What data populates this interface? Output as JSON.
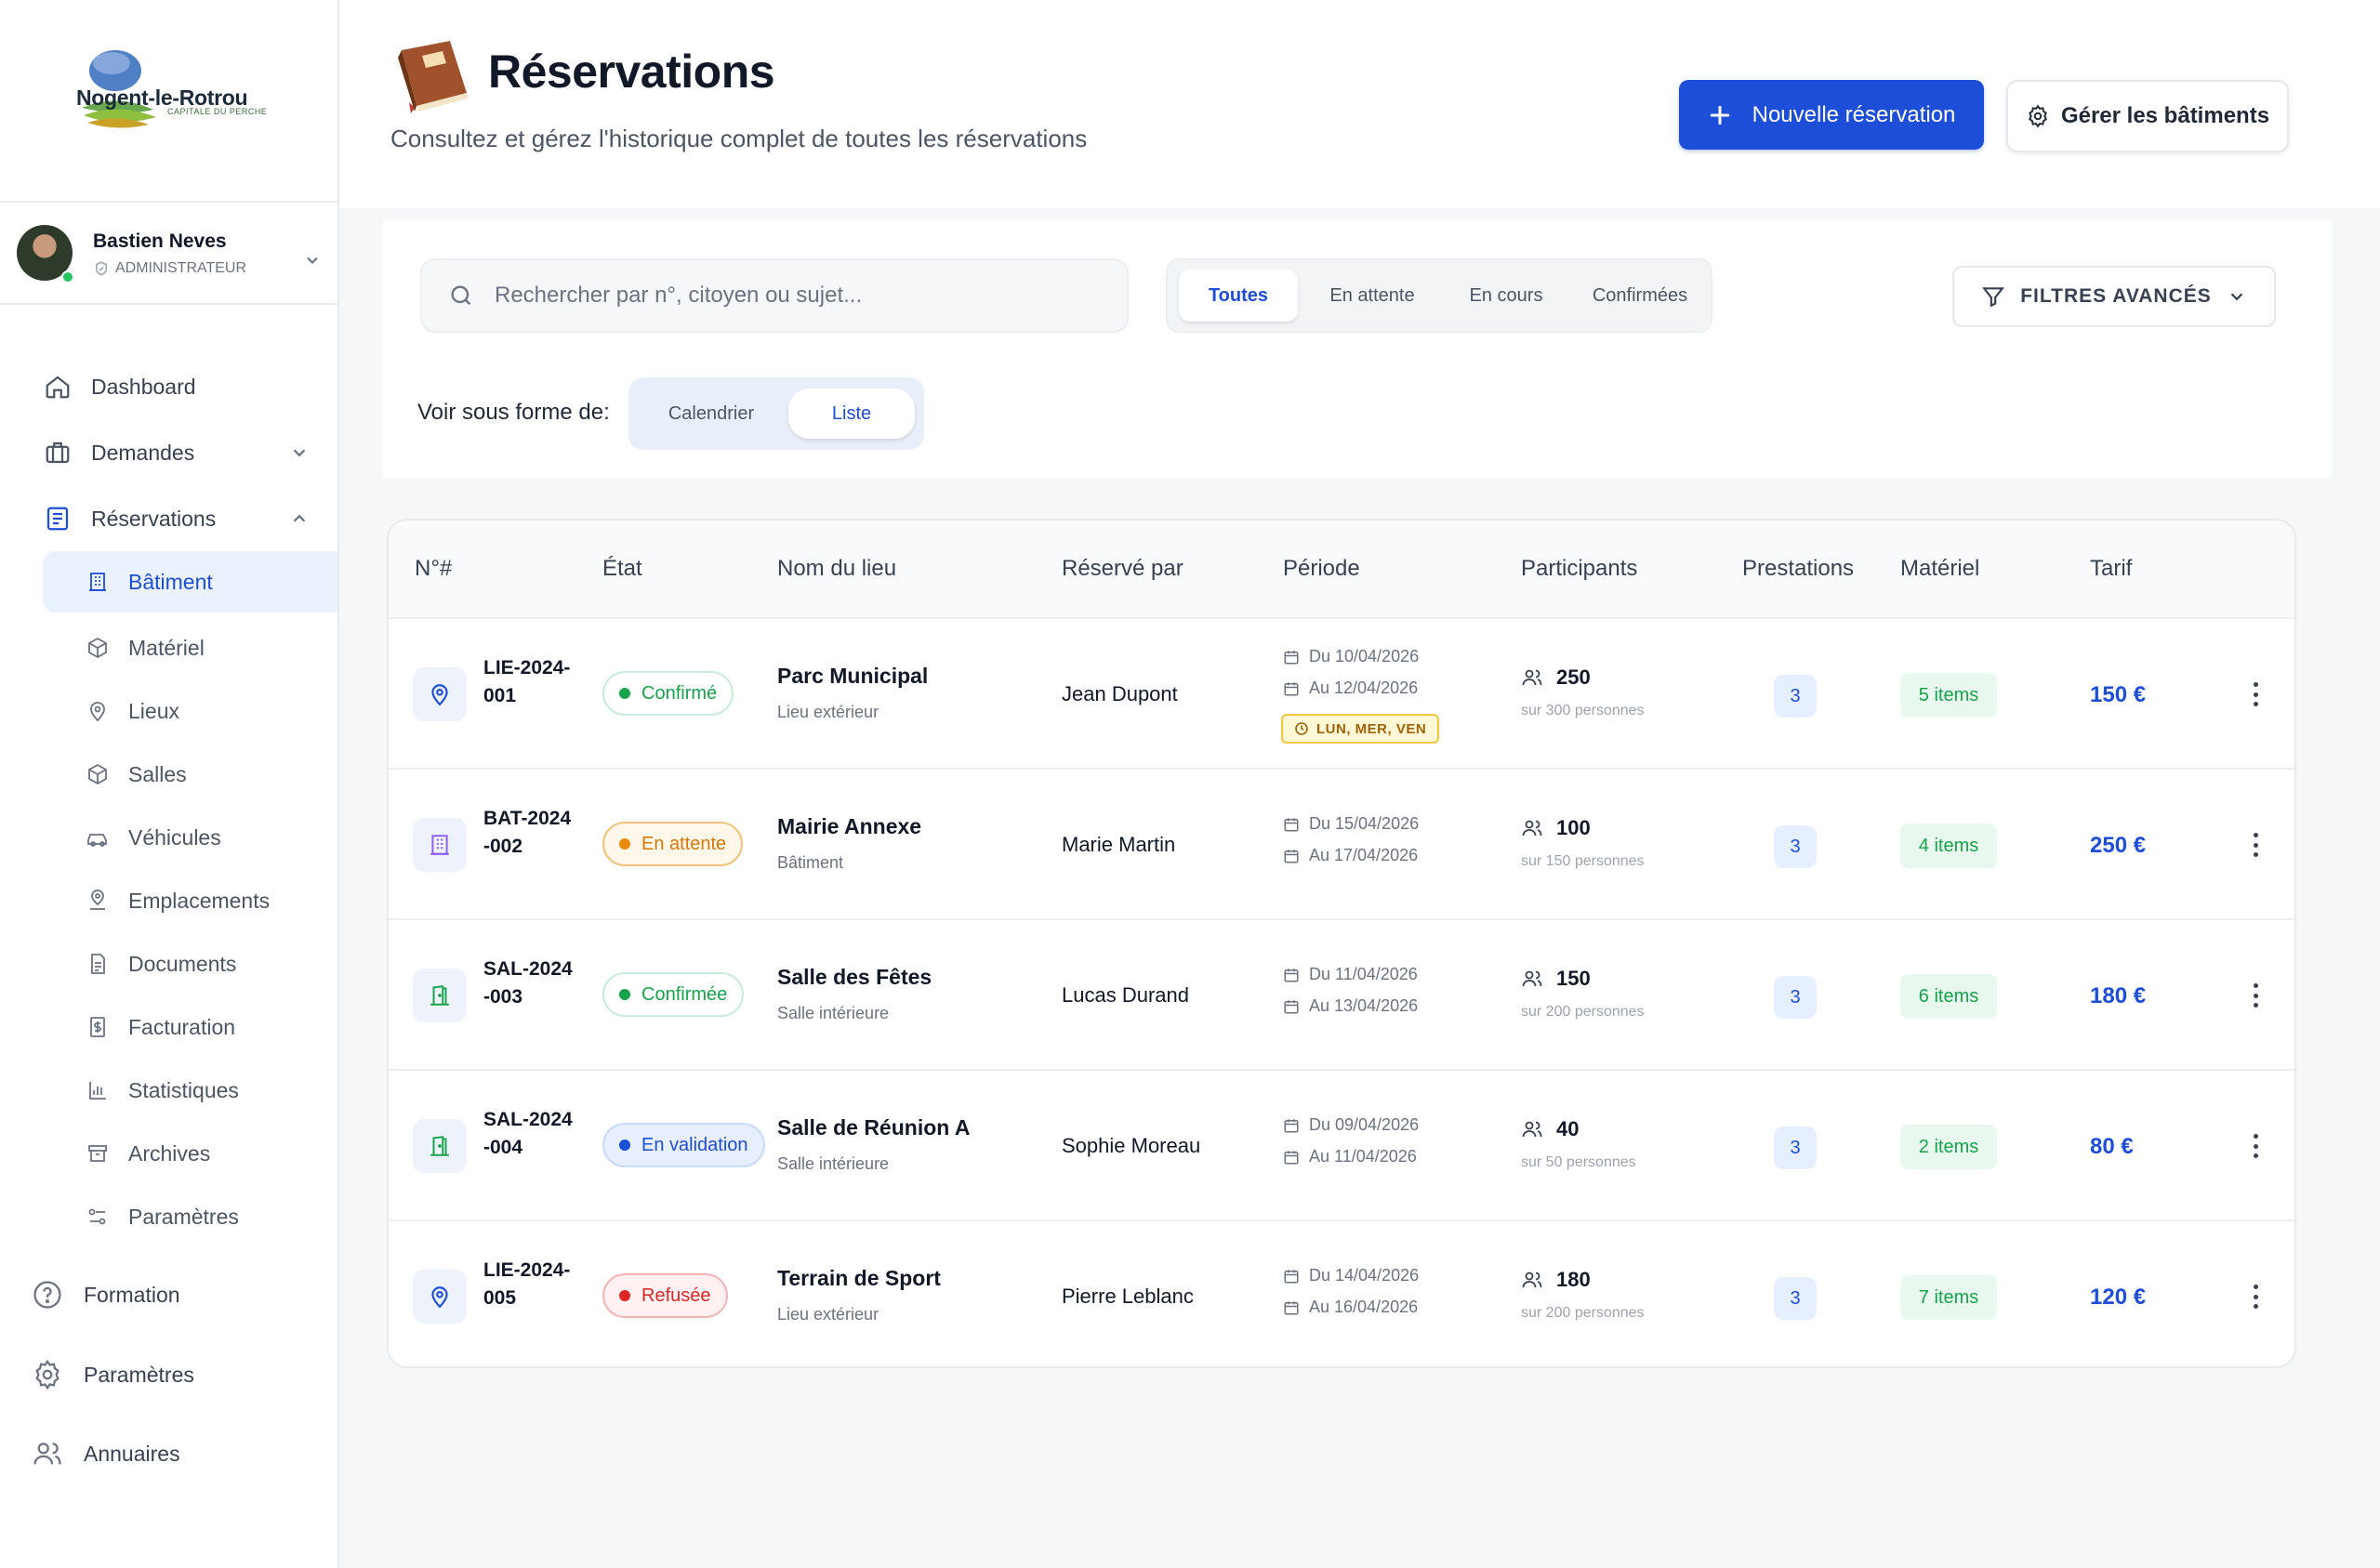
{
  "brand": {
    "name": "Nogent-le-Rotrou",
    "tagline": "CAPITALE DU PERCHE"
  },
  "user": {
    "name": "Bastien Neves",
    "role": "ADMINISTRATEUR"
  },
  "nav": {
    "dashboard": "Dashboard",
    "demandes": "Demandes",
    "reservations": "Réservations",
    "sub": {
      "batiment": "Bâtiment",
      "materiel": "Matériel",
      "lieux": "Lieux",
      "salles": "Salles",
      "vehicules": "Véhicules",
      "emplacements": "Emplacements",
      "documents": "Documents",
      "facturation": "Facturation",
      "statistiques": "Statistiques",
      "archives": "Archives",
      "parametres": "Paramètres"
    },
    "formation": "Formation",
    "parametres": "Paramètres",
    "annuaires": "Annuaires"
  },
  "header": {
    "title": "Réservations",
    "subtitle": "Consultez et gérez l'historique complet de toutes les réservations",
    "new_button": "Nouvelle réservation",
    "manage_button": "Gérer les bâtiments"
  },
  "filters": {
    "search_placeholder": "Rechercher par n°, citoyen ou sujet...",
    "tabs": [
      "Toutes",
      "En attente",
      "En cours",
      "Confirmées"
    ],
    "active_tab": "Toutes",
    "advanced": "FILTRES AVANCÉS",
    "view_label": "Voir sous forme de:",
    "view_options": [
      "Calendrier",
      "Liste"
    ],
    "active_view": "Liste"
  },
  "table": {
    "headers": [
      "N°#",
      "État",
      "Nom du lieu",
      "Réservé par",
      "Période",
      "Participants",
      "Prestations",
      "Matériel",
      "Tarif"
    ],
    "rows": [
      {
        "id": "LIE-2024-001",
        "id_line1": "LIE-2024-",
        "id_line2": "001",
        "type_icon": "location-pin-icon",
        "status": "Confirmé",
        "status_tone": "green",
        "place": "Parc Municipal",
        "place_type": "Lieu extérieur",
        "booked_by": "Jean Dupont",
        "from": "Du 10/04/2026",
        "to": "Au 12/04/2026",
        "days": "LUN, MER, VEN",
        "participants": "250",
        "capacity": "sur 300 personnes",
        "services": "3",
        "equipment": "5 items",
        "price": "150 €"
      },
      {
        "id": "BAT-2024-002",
        "id_line1": "BAT-2024",
        "id_line2": "-002",
        "type_icon": "building-icon",
        "status": "En attente",
        "status_tone": "orange",
        "place": "Mairie Annexe",
        "place_type": "Bâtiment",
        "booked_by": "Marie Martin",
        "from": "Du 15/04/2026",
        "to": "Au 17/04/2026",
        "days": "",
        "participants": "100",
        "capacity": "sur 150 personnes",
        "services": "3",
        "equipment": "4 items",
        "price": "250 €"
      },
      {
        "id": "SAL-2024-003",
        "id_line1": "SAL-2024",
        "id_line2": "-003",
        "type_icon": "door-icon",
        "status": "Confirmée",
        "status_tone": "green",
        "place": "Salle des Fêtes",
        "place_type": "Salle intérieure",
        "booked_by": "Lucas Durand",
        "from": "Du 11/04/2026",
        "to": "Au 13/04/2026",
        "days": "",
        "participants": "150",
        "capacity": "sur 200 personnes",
        "services": "3",
        "equipment": "6 items",
        "price": "180 €"
      },
      {
        "id": "SAL-2024-004",
        "id_line1": "SAL-2024",
        "id_line2": "-004",
        "type_icon": "door-icon",
        "status": "En validation",
        "status_tone": "blue",
        "place": "Salle de Réunion A",
        "place_type": "Salle intérieure",
        "booked_by": "Sophie Moreau",
        "from": "Du 09/04/2026",
        "to": "Au 11/04/2026",
        "days": "",
        "participants": "40",
        "capacity": "sur 50 personnes",
        "services": "3",
        "equipment": "2 items",
        "price": "80 €"
      },
      {
        "id": "LIE-2024-005",
        "id_line1": "LIE-2024-",
        "id_line2": "005",
        "type_icon": "location-pin-icon",
        "status": "Refusée",
        "status_tone": "red",
        "place": "Terrain de Sport",
        "place_type": "Lieu extérieur",
        "booked_by": "Pierre Leblanc",
        "from": "Du 14/04/2026",
        "to": "Au 16/04/2026",
        "days": "",
        "participants": "180",
        "capacity": "sur 200 personnes",
        "services": "3",
        "equipment": "7 items",
        "price": "120 €"
      }
    ]
  },
  "colors": {
    "primary": "#1d4ed8",
    "green": "#16a34a",
    "orange": "#ea8a0c",
    "blue": "#2563eb",
    "red": "#dc2626"
  }
}
